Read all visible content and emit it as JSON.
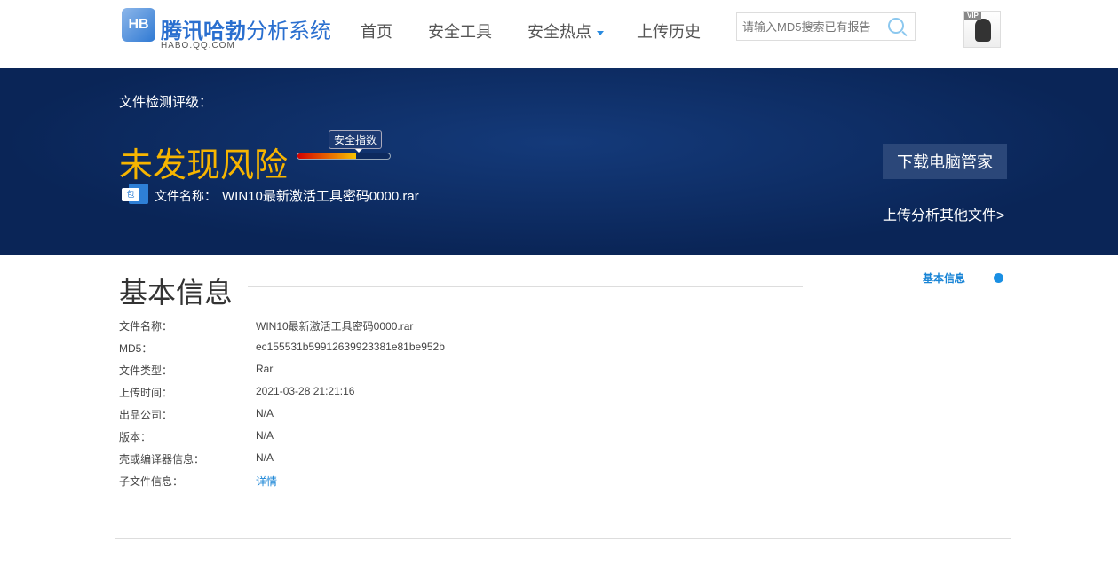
{
  "header": {
    "logo_mark": "HB",
    "logo_title_bold": "腾讯哈勃",
    "logo_title_rest": "分析系统",
    "logo_sub": "HABO.QQ.COM",
    "nav": [
      {
        "label": "首页"
      },
      {
        "label": "安全工具"
      },
      {
        "label": "安全热点"
      },
      {
        "label": "上传历史"
      }
    ],
    "search_placeholder": "请输入MD5搜索已有报告",
    "vip": "VIP"
  },
  "banner": {
    "label": "文件检测评级：",
    "risk": "未发现风险",
    "index_label": "安全指数",
    "safety_index_percent": 63,
    "file_icon_text": "包",
    "file_name_label": "文件名称：",
    "file_name": "WIN10最新激活工具密码0000.rar",
    "download_button": "下载电脑管家",
    "upload_link": "上传分析其他文件>"
  },
  "basic": {
    "title": "基本信息",
    "side_nav": "基本信息",
    "rows": [
      {
        "k": "文件名称：",
        "v": "WIN10最新激活工具密码0000.rar"
      },
      {
        "k": "MD5：",
        "v": "ec155531b59912639923381e81be952b"
      },
      {
        "k": "文件类型：",
        "v": "Rar"
      },
      {
        "k": "上传时间：",
        "v": "2021-03-28 21:21:16"
      },
      {
        "k": "出品公司：",
        "v": "N/A"
      },
      {
        "k": "版本：",
        "v": "N/A"
      },
      {
        "k": "壳或编译器信息：",
        "v": "N/A"
      },
      {
        "k": "子文件信息：",
        "v": "详情"
      }
    ]
  }
}
